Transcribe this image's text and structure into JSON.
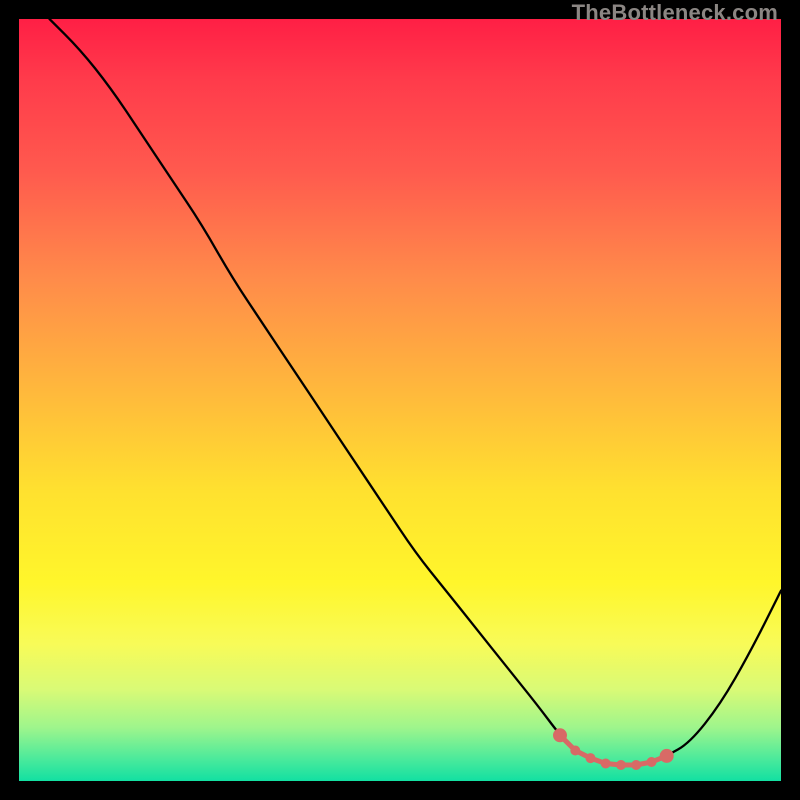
{
  "watermark": "TheBottleneck.com",
  "chart_data": {
    "type": "line",
    "title": "",
    "xlabel": "",
    "ylabel": "",
    "xlim": [
      0,
      100
    ],
    "ylim": [
      0,
      100
    ],
    "series": [
      {
        "name": "bottleneck-curve",
        "x": [
          4,
          8,
          12,
          16,
          20,
          24,
          28,
          32,
          36,
          40,
          44,
          48,
          52,
          56,
          60,
          64,
          68,
          71,
          73,
          75,
          77,
          79,
          81,
          83,
          85,
          88,
          92,
          96,
          100
        ],
        "y": [
          100,
          96,
          91,
          85,
          79,
          73,
          66,
          60,
          54,
          48,
          42,
          36,
          30,
          25,
          20,
          15,
          10,
          6,
          4,
          3,
          2.3,
          2.1,
          2.1,
          2.5,
          3.3,
          5,
          10,
          17,
          25
        ]
      }
    ],
    "markers": {
      "name": "trough-markers",
      "x": [
        71,
        73,
        75,
        77,
        79,
        81,
        83,
        85
      ],
      "y": [
        6,
        4,
        3,
        2.3,
        2.1,
        2.1,
        2.5,
        3.3
      ]
    },
    "colors": {
      "curve": "#000000",
      "marker": "#d86a66",
      "gradient_top": "#ff1f45",
      "gradient_bottom": "#12e0a2"
    }
  }
}
